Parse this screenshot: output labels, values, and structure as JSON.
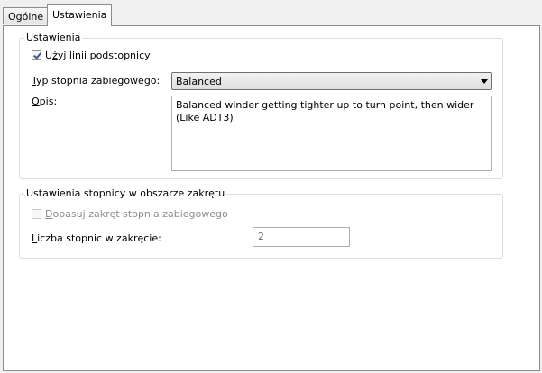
{
  "tabs": [
    {
      "label": "Ogólne",
      "active": false
    },
    {
      "label": "Ustawienia",
      "active": true
    }
  ],
  "settings_group": {
    "title": "Ustawienia",
    "use_riser_lines": {
      "label_prefix": "U",
      "label_underlined": "ż",
      "label_rest": "yj linii podstopnicy",
      "checked": true
    },
    "winder_type": {
      "label_underlined": "T",
      "label_rest": "yp stopnia zabiegowego:",
      "value": "Balanced"
    },
    "description": {
      "label_underlined": "O",
      "label_rest": "pis:",
      "value": "Balanced winder getting tighter up to turn point, then wider (Like ADT3)"
    }
  },
  "turn_group": {
    "title": "Ustawienia stopnicy w obszarze zakrętu",
    "fit_turn": {
      "label_underlined": "D",
      "label_rest": "opasuj zakręt stopnia zabiegowego",
      "checked": false,
      "enabled": false
    },
    "treads_in_turn": {
      "label_underlined": "L",
      "label_rest": "iczba stopnic w zakręcie:",
      "value": "2"
    }
  },
  "colors": {
    "border": "#898c95",
    "group_border": "#d5dfe5",
    "disabled_text": "#8d8d8d",
    "check_mark": "#3d5a8f"
  }
}
